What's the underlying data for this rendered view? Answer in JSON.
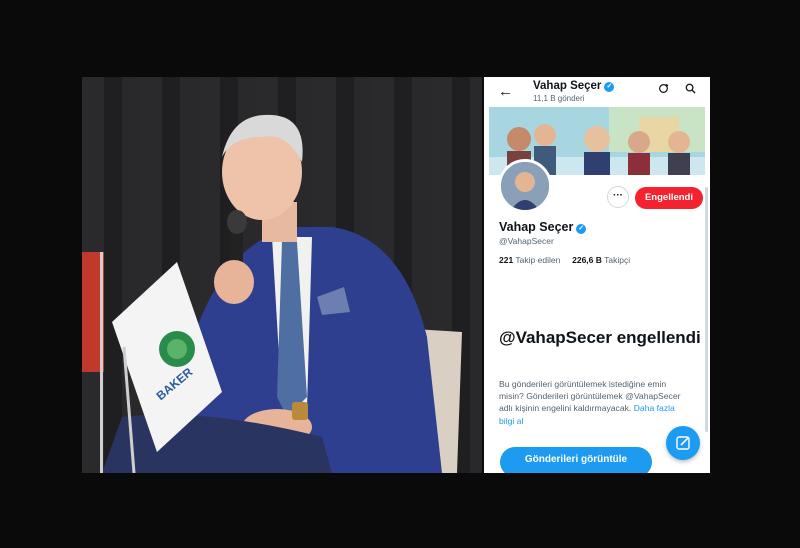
{
  "photo": {
    "flag_lettering": "BAKER"
  },
  "profile_header": {
    "name": "Vahap Seçer",
    "post_count": "11,1 B gönderi",
    "back_icon": "arrow-left-icon",
    "icons": [
      "repost-icon",
      "search-icon"
    ]
  },
  "profile": {
    "name": "Vahap Seçer",
    "handle": "@VahapSecer",
    "following_count": "221",
    "following_label": "Takip edilen",
    "followers_count": "226,6 B",
    "followers_label": "Takipçi",
    "more_label": "···",
    "blocked_button": "Engellendi"
  },
  "blocked_notice": {
    "title": "@VahapSecer engellendi",
    "description": "Bu gönderileri görüntülemek istediğine emin misin? Gönderileri görüntülemek @VahapSecer adlı kişinin engelini kaldırmayacak.",
    "link": "Daha fazla bilgi al",
    "view_button": "Gönderileri görüntüle"
  },
  "colors": {
    "accent": "#1d9bf0",
    "blocked": "#f4212e",
    "text": "#0f1419",
    "muted": "#536471"
  }
}
